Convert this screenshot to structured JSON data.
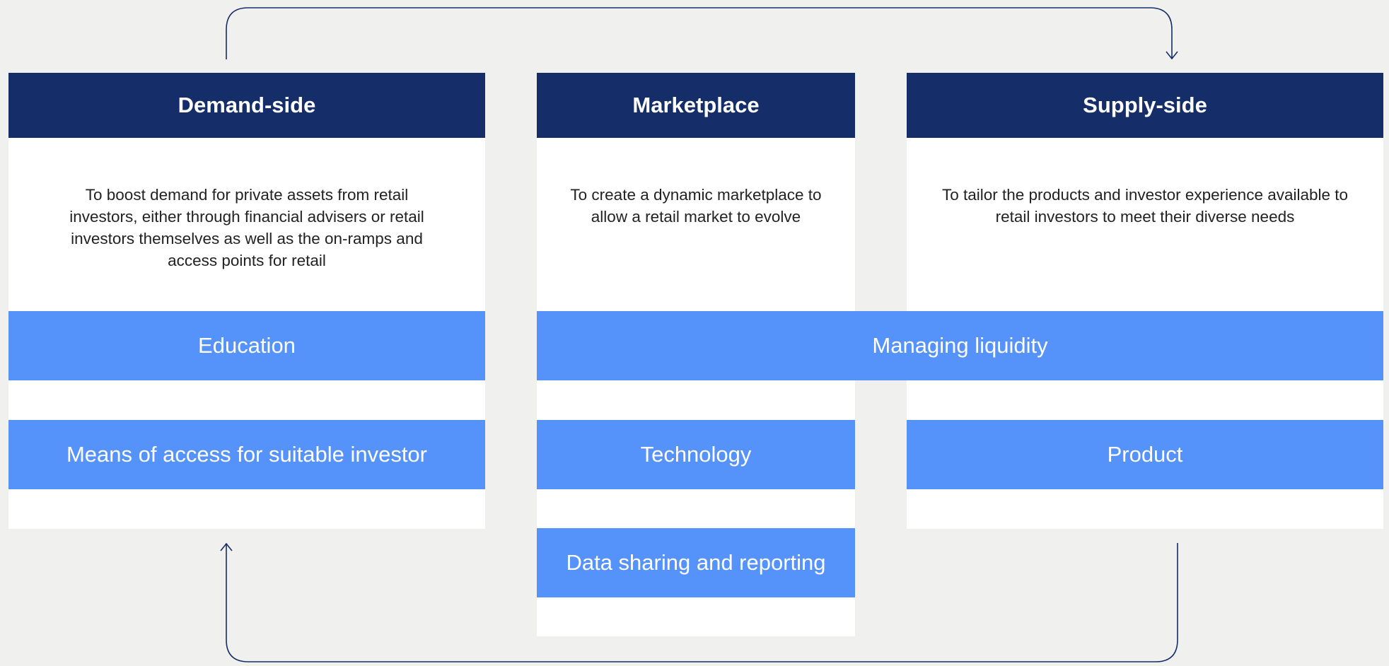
{
  "columns": {
    "demand": {
      "title": "Demand-side",
      "description": "To boost demand for private assets from retail investors, either through financial advisers or retail investors themselves as well as the on-ramps and access points for retail"
    },
    "marketplace": {
      "title": "Marketplace",
      "description": "To create a dynamic marketplace to allow a retail market to evolve"
    },
    "supply": {
      "title": "Supply-side",
      "description": "To tailor the products and investor experience available to retail investors to meet their diverse needs"
    }
  },
  "pillars": {
    "education": "Education",
    "managing_liquidity": "Managing liquidity",
    "means_of_access": "Means of access for suitable investor",
    "technology": "Technology",
    "product": "Product",
    "data_sharing": "Data sharing and reporting"
  },
  "colors": {
    "header": "#152e69",
    "pillar": "#5592f9",
    "background": "#f0f0ee",
    "arrow": "#152e69"
  }
}
